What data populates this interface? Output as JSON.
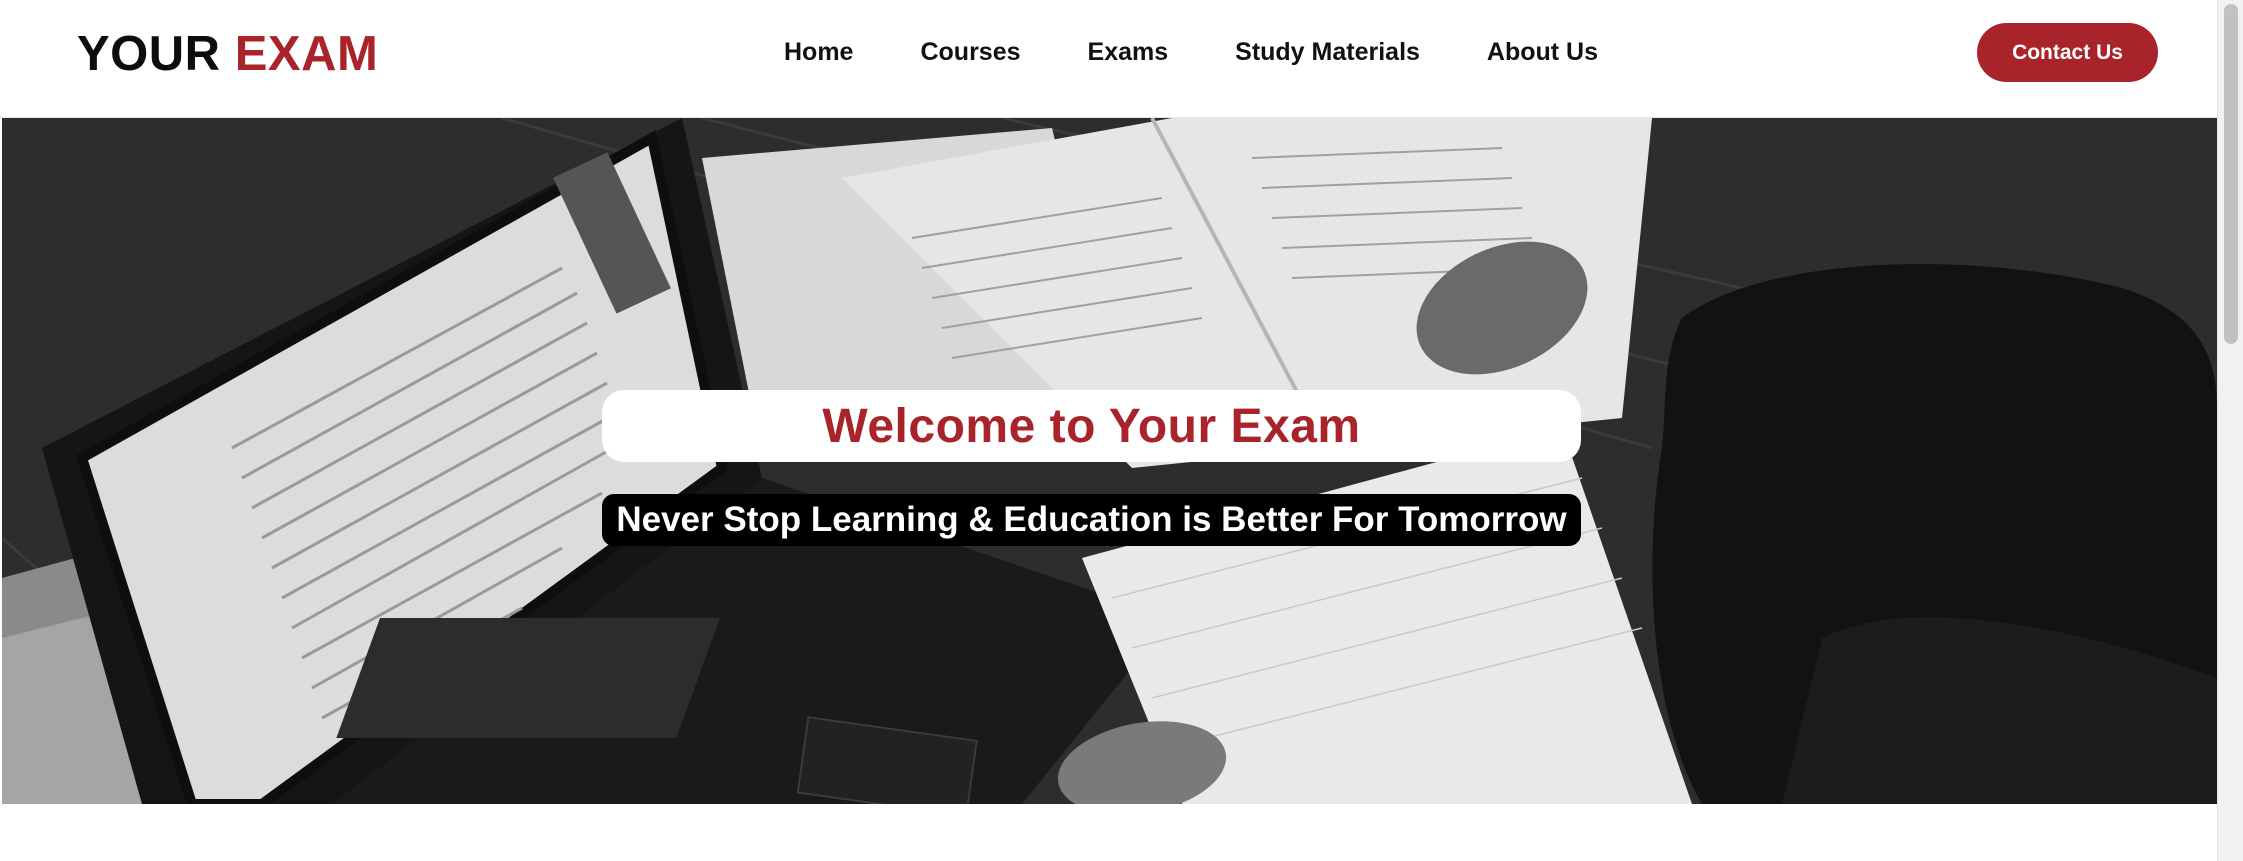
{
  "header": {
    "logo": {
      "word1": "YOUR",
      "word2": "EXAM"
    },
    "nav": [
      {
        "label": "Home"
      },
      {
        "label": "Courses"
      },
      {
        "label": "Exams"
      },
      {
        "label": "Study Materials"
      },
      {
        "label": "About Us"
      }
    ],
    "contact_button": "Contact Us"
  },
  "hero": {
    "title": "Welcome to Your Exam",
    "subtitle": "Never Stop Learning & Education is Better For Tomorrow",
    "background_image": "grayscale photo of a student studying with an open laptop and textbooks"
  },
  "colors": {
    "brand_red": "#a8232a",
    "text_dark": "#0d0d0d",
    "white": "#ffffff",
    "black": "#000000"
  }
}
